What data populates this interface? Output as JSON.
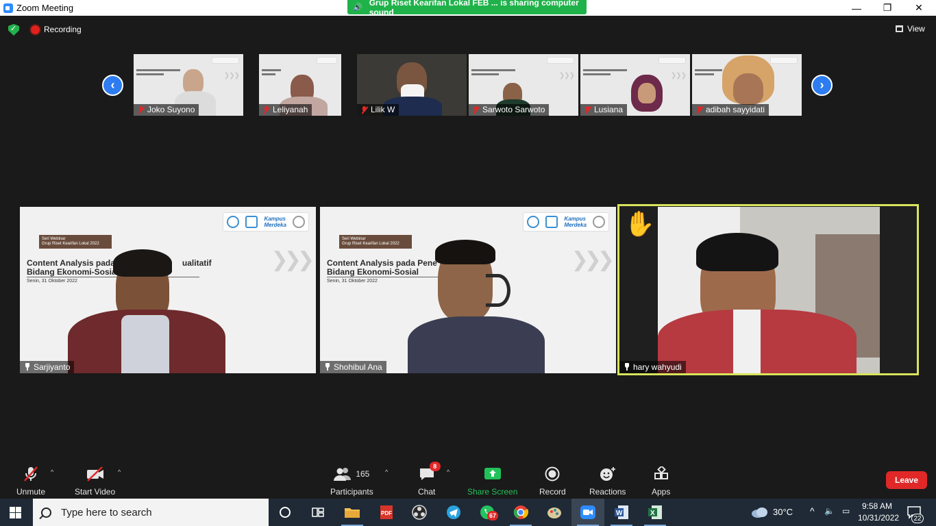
{
  "window": {
    "title": "Zoom Meeting",
    "share_banner": "Grup Riset Kearifan Lokal FEB ... is sharing computer sound"
  },
  "meeting_bar": {
    "recording_label": "Recording",
    "view_label": "View"
  },
  "thumbnails": [
    {
      "name": "Joko Suyono",
      "muted": true
    },
    {
      "name": "Leliyanah",
      "muted": true
    },
    {
      "name": "Lilik W",
      "muted": true
    },
    {
      "name": "Sarwoto Sarwoto",
      "muted": true
    },
    {
      "name": "Lusiana",
      "muted": true
    },
    {
      "name": "adibah sayyidati",
      "muted": true
    }
  ],
  "slide": {
    "series_badge_line1": "Seri Webinar",
    "series_badge_line2": "Grup Riset Kearifan Lokal 2022",
    "title_line1_left": "Content Analysis pada",
    "title_line1_right": "ualitatif",
    "title_line2": "Bidang Ekonomi-Sosial",
    "date": "Senin, 31 Oktober 2022",
    "title_line1_tile2": "Content Analysis pada Pene",
    "logo_text_line1": "Kampus",
    "logo_text_line2": "Merdeka"
  },
  "tiles": [
    {
      "name": "Sarjiyanto"
    },
    {
      "name": "Shohibul Ana"
    },
    {
      "name": "hary wahyudi",
      "hand_raised": true,
      "active_speaker": true
    }
  ],
  "toolbar": {
    "unmute": "Unmute",
    "start_video": "Start Video",
    "participants": "Participants",
    "participants_count": "165",
    "chat": "Chat",
    "chat_badge": "8",
    "share_screen": "Share Screen",
    "record": "Record",
    "reactions": "Reactions",
    "apps": "Apps",
    "leave": "Leave"
  },
  "taskbar": {
    "search_placeholder": "Type here to search",
    "whatsapp_badge": "67",
    "weather": "30°C",
    "time": "9:58 AM",
    "date": "10/31/2022",
    "notifications": "22"
  },
  "colors": {
    "share_green": "#20b24a",
    "recording_red": "#e02828",
    "active_speaker_border": "#d9e45c",
    "nav_blue": "#2d7cf0",
    "taskbar_bg": "#1f2a36"
  }
}
